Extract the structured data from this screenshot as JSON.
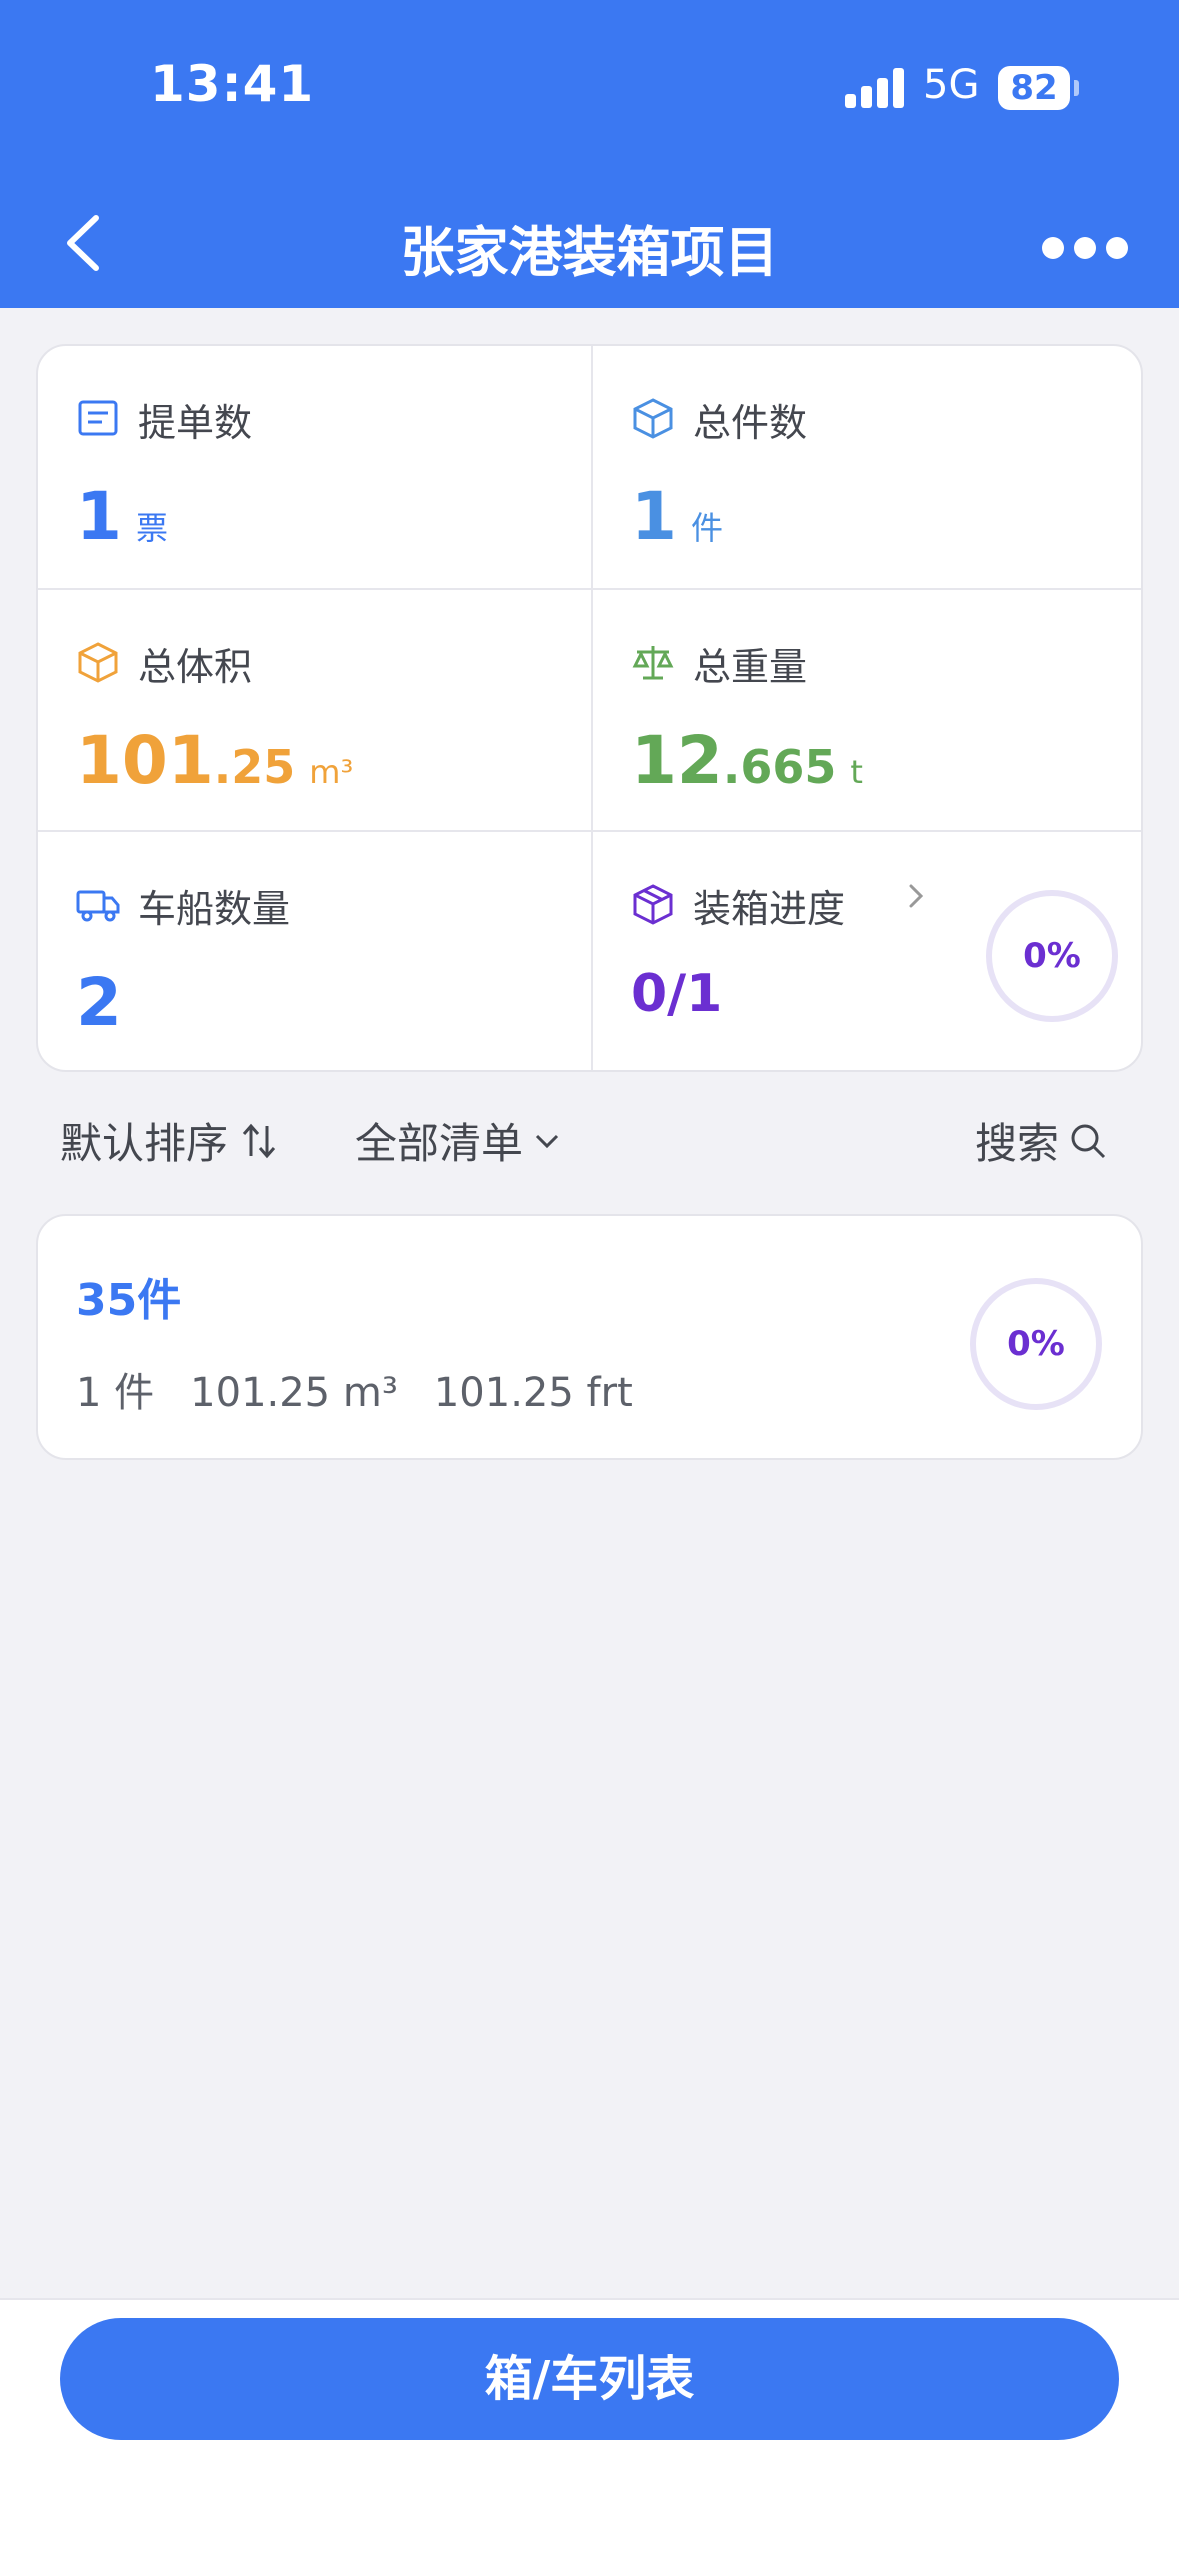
{
  "status_bar": {
    "time": "13:41",
    "network": "5G",
    "battery": "82"
  },
  "nav": {
    "title": "张家港装箱项目"
  },
  "stats": {
    "bills": {
      "label": "提单数",
      "value": "1",
      "unit": "票"
    },
    "pieces": {
      "label": "总件数",
      "value": "1",
      "unit": "件"
    },
    "volume": {
      "label": "总体积",
      "int": "101",
      "dec": ".25",
      "unit": "m³"
    },
    "weight": {
      "label": "总重量",
      "int": "12",
      "dec": ".665",
      "unit": "t"
    },
    "vehicles": {
      "label": "车船数量",
      "value": "2"
    },
    "progress": {
      "label": "装箱进度",
      "value": "0/1",
      "percent": "0%"
    }
  },
  "filters": {
    "sort": "默认排序",
    "list": "全部清单",
    "search": "搜索"
  },
  "list": [
    {
      "title": "35件",
      "count": "1 件",
      "volume": "101.25 m³",
      "freight": "101.25 frt",
      "percent": "0%"
    }
  ],
  "footer": {
    "button": "箱/车列表"
  },
  "colors": {
    "primary": "#3b78f2",
    "orange": "#f0a23a",
    "green": "#63a857",
    "purple": "#6b2fd1"
  }
}
